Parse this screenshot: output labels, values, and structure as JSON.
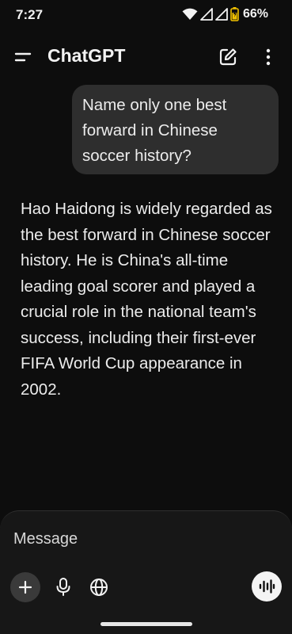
{
  "status_bar": {
    "time": "7:27",
    "battery_percent": "66%",
    "icons": [
      "wifi-icon",
      "signal-icon",
      "signal-icon",
      "battery-icon"
    ]
  },
  "header": {
    "title": "ChatGPT",
    "icons": [
      "menu-icon",
      "edit-icon",
      "more-vertical-icon"
    ]
  },
  "conversation": {
    "user_message": "Name only one best forward in Chinese soccer history?",
    "assistant_message": "Hao Haidong is widely regarded as the best forward in Chinese soccer history. He is China's all-time leading goal scorer and played a crucial role in the national team's success, including their first-ever FIFA World Cup appearance in 2002."
  },
  "composer": {
    "placeholder": "Message",
    "icons": [
      "plus-icon",
      "microphone-icon",
      "globe-icon",
      "voice-mode-icon"
    ]
  },
  "colors": {
    "background": "#0d0d0d",
    "user_bubble": "#2e2e2e",
    "composer": "#171717",
    "text": "#ececec"
  }
}
